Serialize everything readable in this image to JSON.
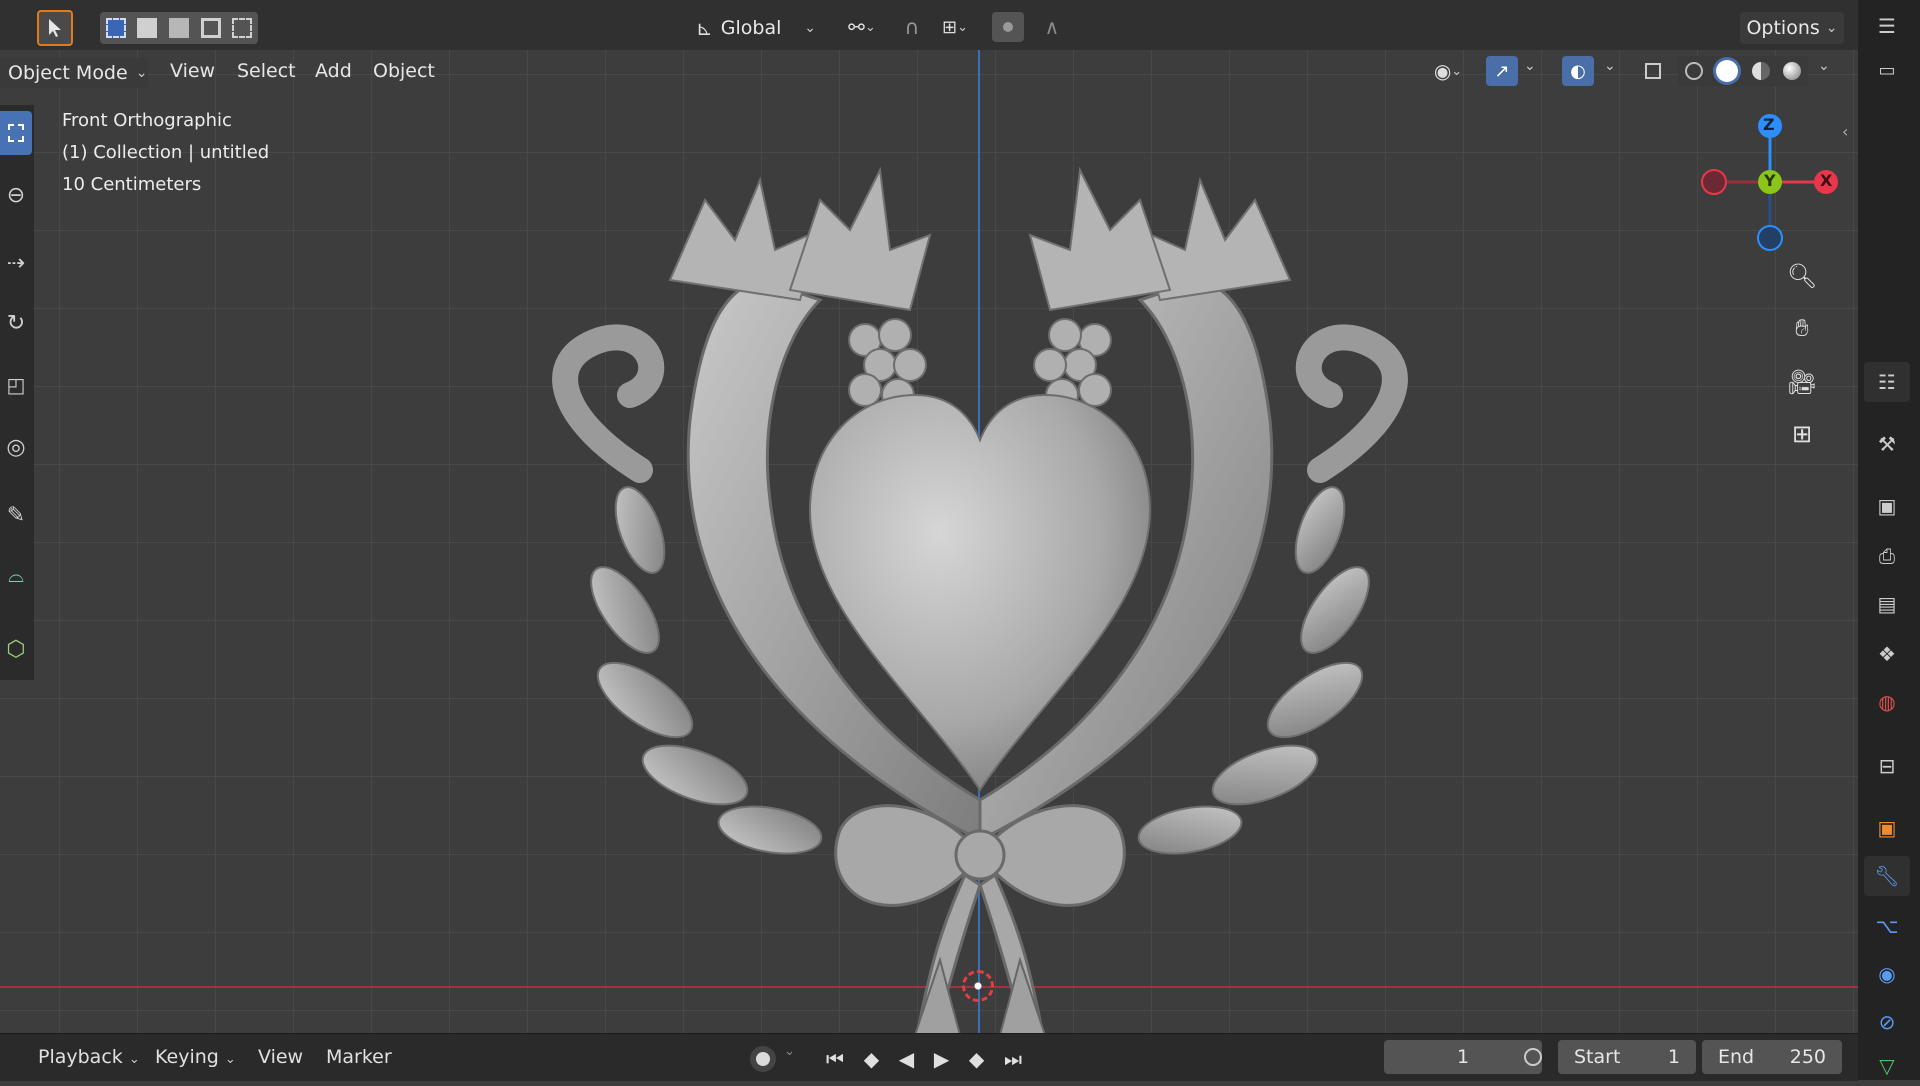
{
  "header": {
    "transform_orientation": "Global",
    "options_label": "Options"
  },
  "menubar": {
    "mode": "Object Mode",
    "items": [
      "View",
      "Select",
      "Add",
      "Object"
    ]
  },
  "overlay_info": {
    "view_name": "Front Orthographic",
    "collection": "(1) Collection | untitled",
    "scale": "10 Centimeters"
  },
  "gizmo": {
    "z_label": "Z",
    "y_label": "Y",
    "x_label": "X",
    "colors": {
      "x": "#e8364b",
      "y": "#8bc41a",
      "z": "#2c8fff"
    }
  },
  "timeline": {
    "menus": [
      "Playback",
      "Keying",
      "View",
      "Marker"
    ],
    "current_frame": "1",
    "start_label": "Start",
    "start_value": "1",
    "end_label": "End",
    "end_value": "250"
  },
  "icons": {
    "left_tools": [
      "select-box-icon",
      "cursor-icon",
      "move-icon",
      "rotate-icon",
      "scale-icon",
      "transform-icon",
      "annotate-icon",
      "measure-icon",
      "add-cube-icon"
    ],
    "right_tabs": [
      "tool-icon",
      "render-icon",
      "output-icon",
      "view-layer-icon",
      "scene-icon",
      "world-icon",
      "collection-icon",
      "object-icon",
      "modifier-icon",
      "particles-icon",
      "physics-icon",
      "constraints-icon",
      "data-icon"
    ]
  }
}
